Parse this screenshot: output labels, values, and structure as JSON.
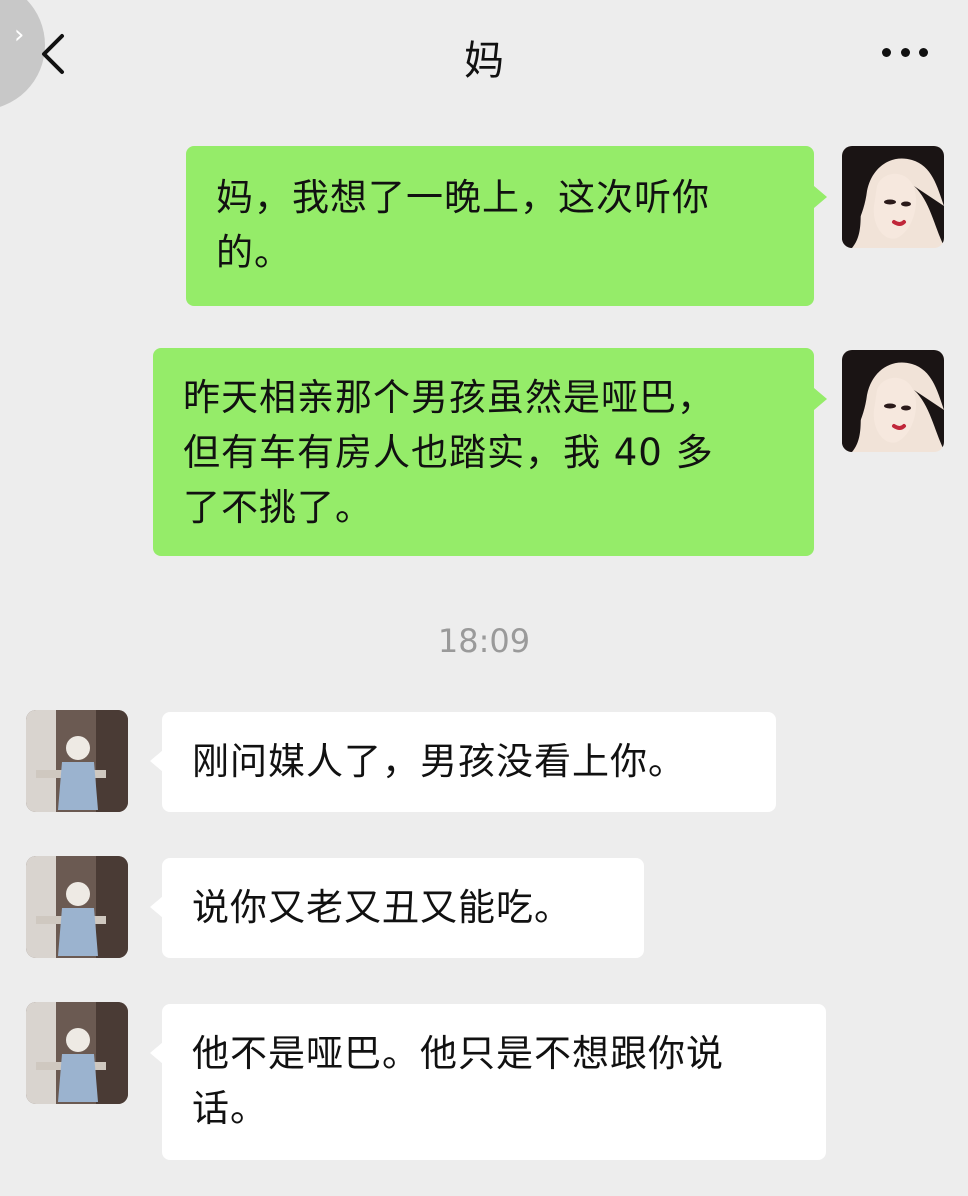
{
  "header": {
    "title": "妈",
    "back_icon": "chevron-left-icon",
    "more_icon": "more-dots-icon"
  },
  "messages": [
    {
      "side": "right",
      "text": "妈，我想了一晚上，这次听你的。",
      "lines": [
        "妈，我想了一晚上，这次听你",
        "的。"
      ]
    },
    {
      "side": "right",
      "text": "昨天相亲那个男孩虽然是哑巴，但有车有房人也踏实，我40多了不挑了。",
      "lines": [
        "昨天相亲那个男孩虽然是哑巴，",
        "但有车有房人也踏实，我 40 多",
        "了不挑了。"
      ]
    },
    {
      "side": "left",
      "text": "刚问媒人了，男孩没看上你。",
      "lines": [
        "刚问媒人了，男孩没看上你。"
      ]
    },
    {
      "side": "left",
      "text": "说你又老又丑又能吃。",
      "lines": [
        "说你又老又丑又能吃。"
      ]
    },
    {
      "side": "left",
      "text": "他不是哑巴。他只是不想跟你说话。",
      "lines": [
        "他不是哑巴。他只是不想跟你说",
        "话。"
      ]
    }
  ],
  "timestamp": "18:09",
  "colors": {
    "background": "#ededed",
    "sent_bubble": "#95ec69",
    "received_bubble": "#ffffff",
    "timestamp_text": "#9a9a9a"
  }
}
